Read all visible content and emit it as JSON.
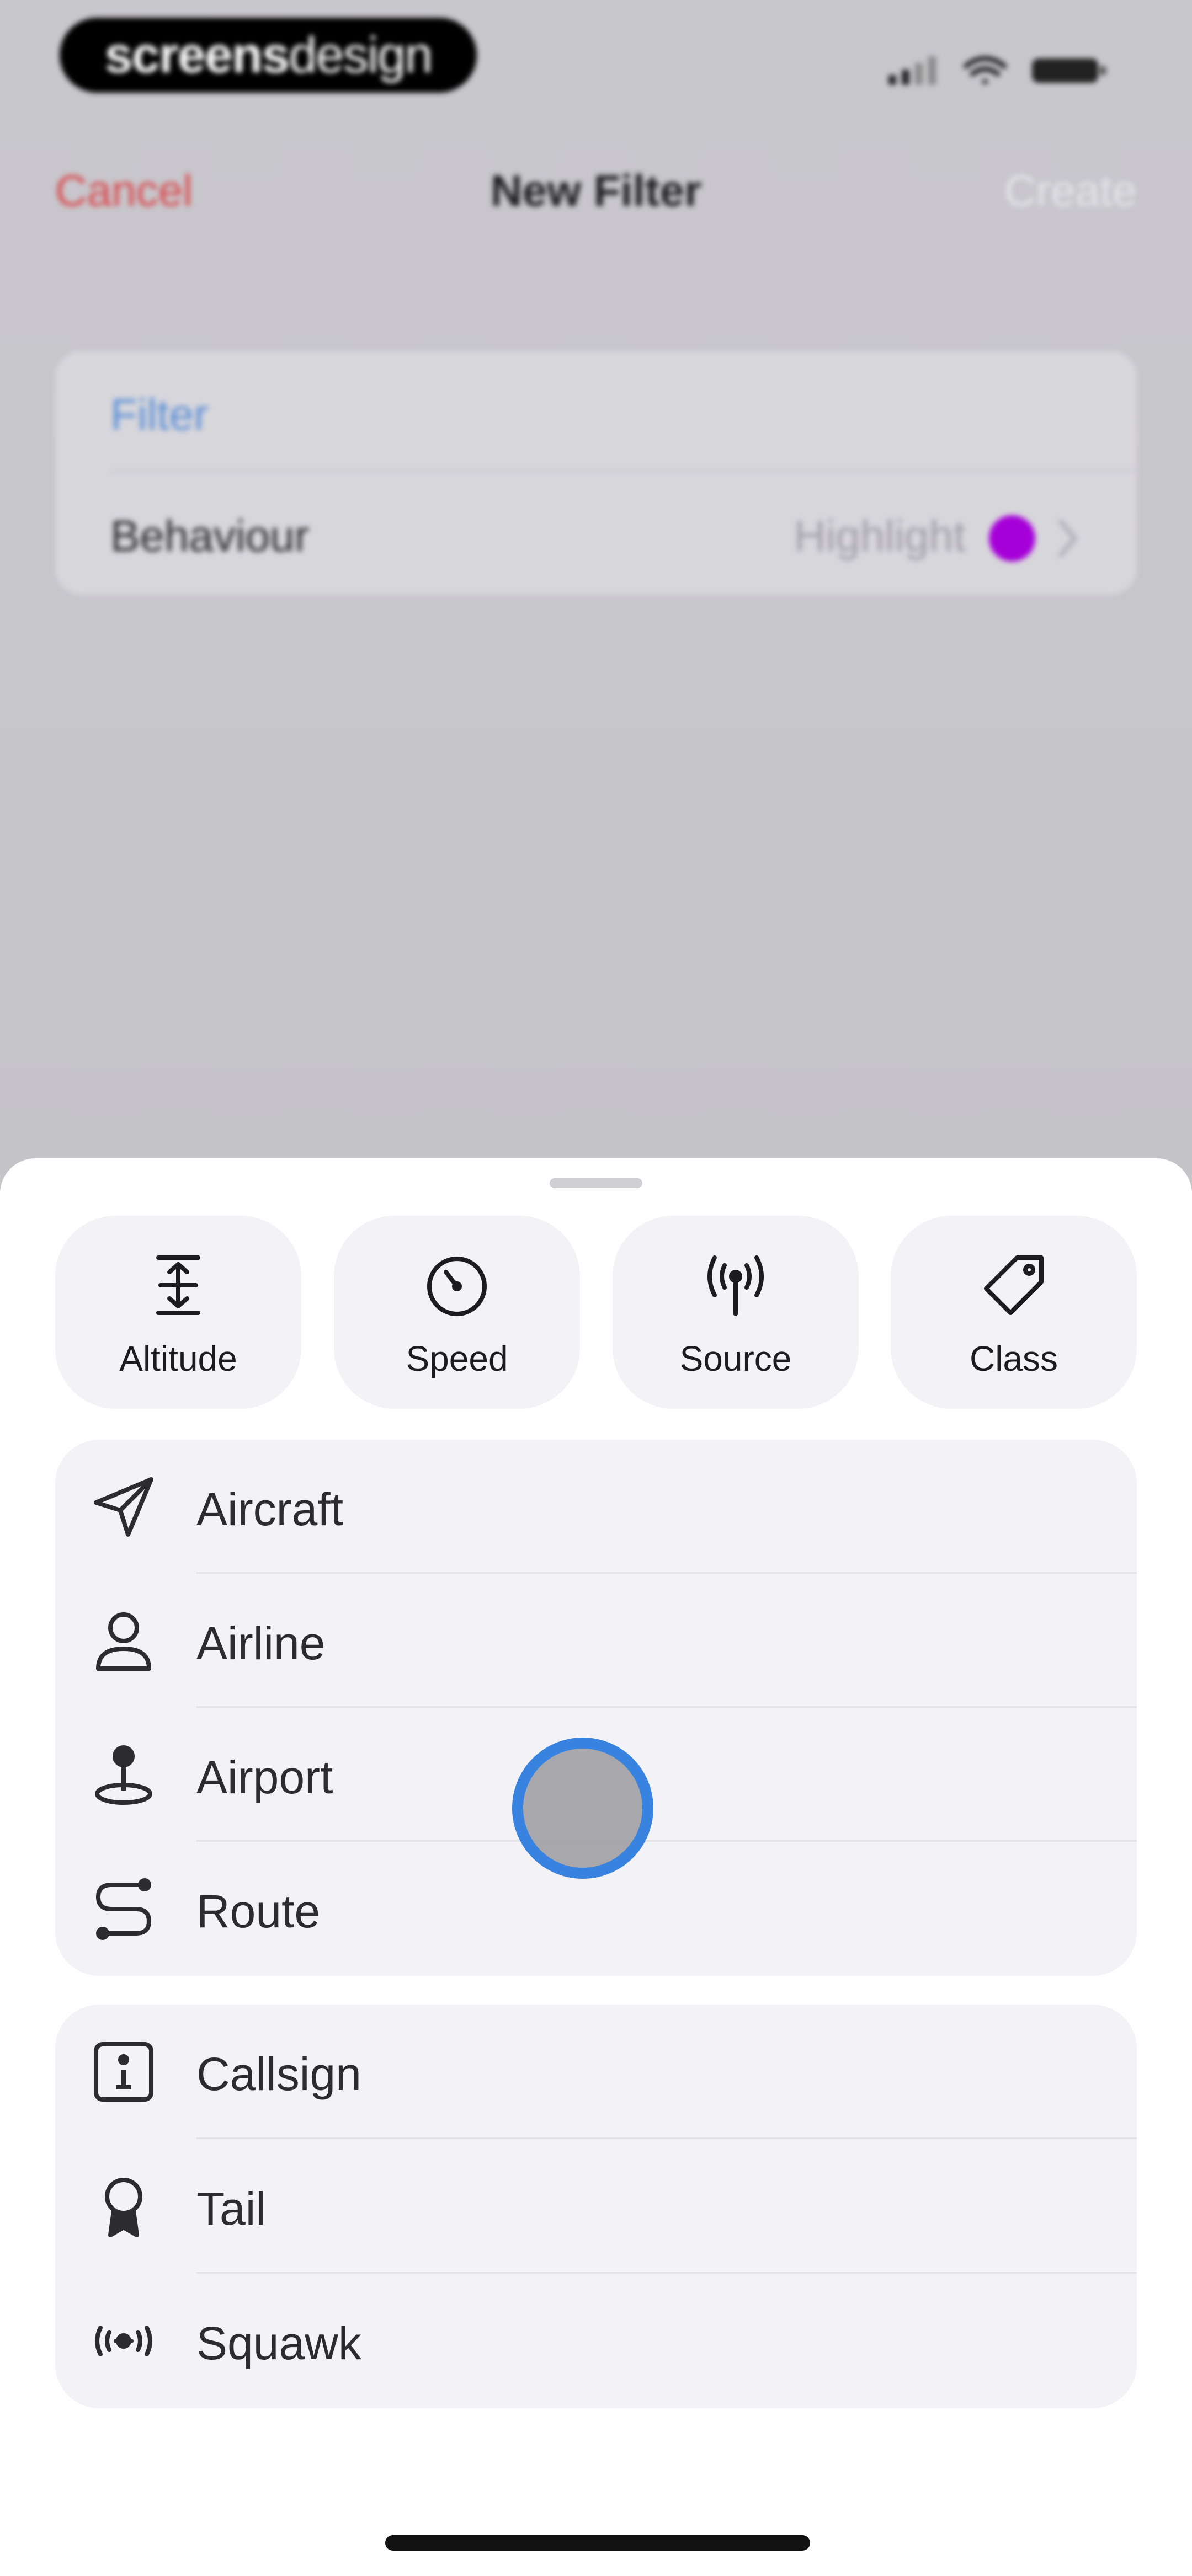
{
  "watermark": {
    "bold": "screens",
    "light": "design"
  },
  "nav": {
    "cancel_label": "Cancel",
    "title": "New Filter",
    "create_label": "Create"
  },
  "form": {
    "filter_label": "Filter",
    "behaviour_label": "Behaviour",
    "behaviour_value": "Highlight",
    "highlight_color": "#a500d8"
  },
  "sheet": {
    "chips": [
      {
        "label": "Altitude",
        "icon": "altitude-icon"
      },
      {
        "label": "Speed",
        "icon": "speedometer-icon"
      },
      {
        "label": "Source",
        "icon": "antenna-icon"
      },
      {
        "label": "Class",
        "icon": "tag-icon"
      }
    ],
    "group_1": [
      {
        "label": "Aircraft",
        "icon": "paper-plane-icon"
      },
      {
        "label": "Airline",
        "icon": "person-icon"
      },
      {
        "label": "Airport",
        "icon": "location-pin-icon"
      },
      {
        "label": "Route",
        "icon": "route-icon"
      }
    ],
    "group_2": [
      {
        "label": "Callsign",
        "icon": "info-square-icon"
      },
      {
        "label": "Tail",
        "icon": "award-ribbon-icon"
      },
      {
        "label": "Squawk",
        "icon": "transponder-icon"
      }
    ]
  },
  "colors": {
    "accent_blue": "#5b8fd6",
    "cancel_red": "#d8474a",
    "touch_ring": "#2f7ddf"
  }
}
